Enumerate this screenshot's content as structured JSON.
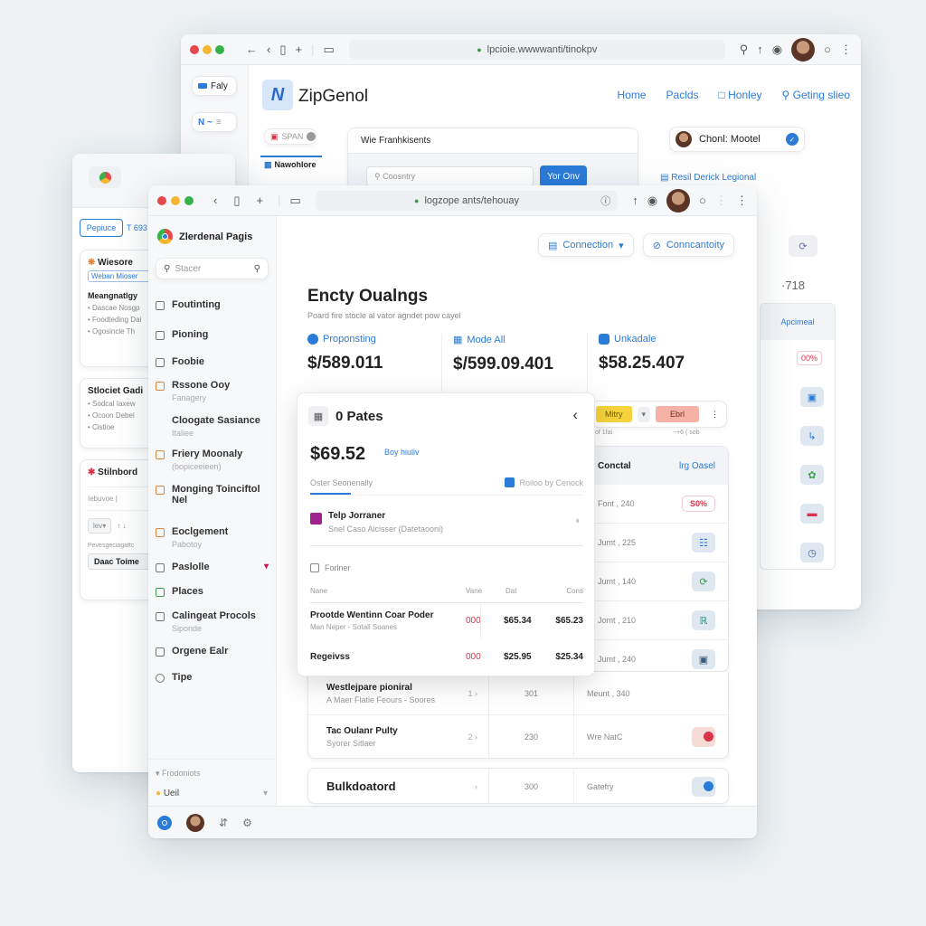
{
  "back_window": {
    "url": "lpcioie.wwwwanti/tinokpv",
    "left_pills": [
      "Faly",
      "N ~"
    ],
    "app_name": "ZipGenol",
    "nav": [
      "Home",
      "Paclds",
      "Honley",
      "Geting slieo"
    ],
    "tag_chip": "SPAN",
    "nav_tab": "Nawohlore",
    "panel_title": "Wie Franhkisents",
    "search_placeholder": "Coosntry",
    "search_button": "Yor Onv",
    "user_chip": "Chonl: Mootel",
    "legal_link": "Resil Derick Legional",
    "counter": "·718",
    "table_header": "Apcimeal",
    "badge": "00%"
  },
  "left_window": {
    "tab_selected": "Pepiuce",
    "tab_other": "T 693",
    "card1_title": "Wiesore",
    "card1_button": "Weban Mioser",
    "card1_heading": "Meangnatlgy",
    "card1_items": [
      "Dascae Nosgp",
      "Foodteding Dai",
      "Ogosincle Th"
    ],
    "card2_title": "Stlociet Gadi",
    "card2_items": [
      "Sodcal Iaxew",
      "Ocoon Debel",
      "Cistioe"
    ],
    "card3_title": "Stilnbord",
    "card3_field": "Iebuvoe",
    "card3_select": "lev",
    "card3_label": "Pevesgeciagaftc",
    "card3_button": "Daac Toime"
  },
  "front_window": {
    "url": "loɡzope ants/tehouay",
    "sidebar": {
      "title": "Zlerdenal Pagis",
      "search_placeholder": "Stacer",
      "items": [
        {
          "label": "Foutinting",
          "sub": ""
        },
        {
          "label": "Pioning",
          "sub": ""
        },
        {
          "label": "Foobie",
          "sub": ""
        },
        {
          "label": "Rssone Ooy",
          "sub": "Fanagery"
        },
        {
          "label": "Cloogate Sasiance",
          "sub": "Italiee"
        },
        {
          "label": "Friery Moonaly",
          "sub": "(bopiceeieen)"
        },
        {
          "label": "Monging Toinciftol Nel",
          "sub": ""
        },
        {
          "label": "Eoclgement",
          "sub": "Pabotoy"
        },
        {
          "label": "Paslolle",
          "sub": ""
        },
        {
          "label": "Places",
          "sub": ""
        },
        {
          "label": "Calingeat Procols",
          "sub": "Siponde"
        },
        {
          "label": "Orgene Ealr",
          "sub": ""
        },
        {
          "label": "Tipe",
          "sub": ""
        }
      ],
      "footer_group": "Frodoniots",
      "footer_item": "Ueil"
    },
    "toolbar": {
      "connection": "Connection",
      "connectivity": "Conncantoity"
    },
    "page_title": "Encty Oualngs",
    "page_subtitle": "Poard fire stocle al vator agndet pow cayel",
    "stats": [
      {
        "label": "Proponsting",
        "value": "$/589.011"
      },
      {
        "label": "Mode All",
        "value": "$/599.09.401"
      },
      {
        "label": "Unkadale",
        "value": "$58.25.407"
      }
    ],
    "action_bar": {
      "yellow": "Mitry",
      "red": "Ebrl",
      "sub_left": "of 1fai",
      "sub_right": "~+6 ( sob"
    },
    "right_table": {
      "headers": [
        "Conctal",
        "lrg Oasel"
      ],
      "rows": [
        {
          "label": "Font , 240",
          "badge": "S0%"
        },
        {
          "label": "Jumt , 225",
          "badge": ""
        },
        {
          "label": "Jumt , 140",
          "badge": ""
        },
        {
          "label": "Jomt , 210",
          "badge": ""
        },
        {
          "label": "Jumt , 240",
          "badge": ""
        }
      ]
    },
    "lower_rows": [
      {
        "title": "Westlejpare pioniral",
        "sub": "A Maer Flatie Feours - Soores",
        "num": "1",
        "val": "301",
        "col": "Meunt , 340"
      },
      {
        "title": "Tac Oulanr Pulty",
        "sub": "Syorer Sitlaer",
        "num": "2",
        "val": "230",
        "col": "Wre NatC"
      },
      {
        "title": "Bulkdoatord",
        "sub": "",
        "num": "",
        "val": "300",
        "col": "Gatefry"
      }
    ],
    "popup": {
      "title": "0 Pates",
      "price": "$69.52",
      "price_link": "Boy hiuliv",
      "tab_active": "Oster Seonenally",
      "tab_right": "Roiloo by Cenock",
      "item_title": "Telp Jorraner",
      "item_sub": "Snel Caso Aicisser (Datetaooni)",
      "filter_label": "Forlner",
      "table_headers": [
        "Nane",
        "Vane",
        "Dat",
        "Cons"
      ],
      "rows": [
        {
          "name": "Prootde Wentinn Coar Poder",
          "sub": "Man Neper - Sotall Soanes",
          "v": "000",
          "d": "$65.34",
          "c": "$65.23"
        },
        {
          "name": "Regeivss",
          "sub": "",
          "v": "000",
          "d": "$25.95",
          "c": "$25.34"
        }
      ]
    }
  },
  "colors": {
    "accent": "#2b7bd8",
    "red": "#d8344b",
    "yellow": "#f6d33c",
    "salmon": "#f6b2a5",
    "purple": "#a0238d"
  }
}
